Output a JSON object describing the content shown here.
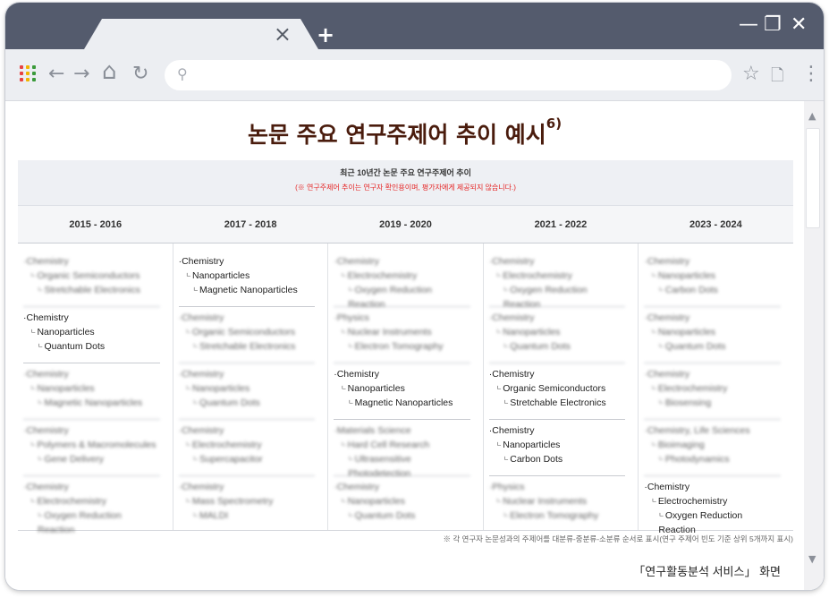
{
  "browser": {
    "tab_close": "×",
    "new_tab": "+",
    "window_controls": {
      "minimize": "—",
      "restore": "❐",
      "close": "✕"
    },
    "toolbar": {
      "back": "←",
      "forward": "→",
      "home": "⌂",
      "reload": "↻",
      "bookmark": "☆",
      "page": "🗋",
      "menu": "⋮",
      "address_value": ""
    },
    "icons": [
      "apps-icon",
      "back-icon",
      "forward-icon",
      "home-icon",
      "reload-icon",
      "search-icon",
      "star-icon",
      "page-icon",
      "menu-icon"
    ],
    "accent_color": "#545b6d"
  },
  "page": {
    "title": "논문 주요 연구주제어 추이 예시",
    "title_sup": "6)",
    "panel_title": "최근 10년간 논문 주요 연구주제어 추이",
    "panel_note": "(※ 연구주제어 추이는 연구자 확인용이며, 평가자에게 제공되지 않습니다.)",
    "years": [
      "2015 - 2016",
      "2017 - 2018",
      "2019 - 2020",
      "2021 - 2022",
      "2023 - 2024"
    ],
    "columns": [
      {
        "entries": [
          {
            "blurred": true,
            "l1": "Chemistry",
            "l2": "Organic Semiconductors",
            "l3": "Stretchable Electronics"
          },
          {
            "blurred": false,
            "l1": "Chemistry",
            "l2": "Nanoparticles",
            "l3": "Quantum Dots"
          },
          {
            "blurred": true,
            "l1": "Chemistry",
            "l2": "Nanoparticles",
            "l3": "Magnetic Nanoparticles"
          },
          {
            "blurred": true,
            "l1": "Chemistry",
            "l2": "Polymers & Macromolecules",
            "l3": "Gene Delivery"
          },
          {
            "blurred": true,
            "l1": "Chemistry",
            "l2": "Electrochemistry",
            "l3": "Oxygen Reduction Reaction"
          }
        ]
      },
      {
        "entries": [
          {
            "blurred": false,
            "l1": "Chemistry",
            "l2": "Nanoparticles",
            "l3": "Magnetic Nanoparticles"
          },
          {
            "blurred": true,
            "l1": "Chemistry",
            "l2": "Organic Semiconductors",
            "l3": "Stretchable Electronics"
          },
          {
            "blurred": true,
            "l1": "Chemistry",
            "l2": "Nanoparticles",
            "l3": "Quantum Dots"
          },
          {
            "blurred": true,
            "l1": "Chemistry",
            "l2": "Electrochemistry",
            "l3": "Supercapacitor"
          },
          {
            "blurred": true,
            "l1": "Chemistry",
            "l2": "Mass Spectrometry",
            "l3": "MALDI"
          }
        ]
      },
      {
        "entries": [
          {
            "blurred": true,
            "l1": "Chemistry",
            "l2": "Electrochemistry",
            "l3": "Oxygen Reduction Reaction"
          },
          {
            "blurred": true,
            "l1": "Physics",
            "l2": "Nuclear Instruments",
            "l3": "Electron Tomography"
          },
          {
            "blurred": false,
            "l1": "Chemistry",
            "l2": "Nanoparticles",
            "l3": "Magnetic Nanoparticles"
          },
          {
            "blurred": true,
            "l1": "Materials Science",
            "l2": "Hard Cell Research",
            "l3": "Ultrasensitive Photodetection"
          },
          {
            "blurred": true,
            "l1": "Chemistry",
            "l2": "Nanoparticles",
            "l3": "Quantum Dots"
          }
        ]
      },
      {
        "entries": [
          {
            "blurred": true,
            "l1": "Chemistry",
            "l2": "Electrochemistry",
            "l3": "Oxygen Reduction Reaction"
          },
          {
            "blurred": true,
            "l1": "Chemistry",
            "l2": "Nanoparticles",
            "l3": "Quantum Dots"
          },
          {
            "blurred": false,
            "l1": "Chemistry",
            "l2": "Organic Semiconductors",
            "l3": "Stretchable Electronics"
          },
          {
            "blurred": false,
            "l1": "Chemistry",
            "l2": "Nanoparticles",
            "l3": "Carbon Dots"
          },
          {
            "blurred": true,
            "l1": "Physics",
            "l2": "Nuclear Instruments",
            "l3": "Electron Tomography"
          }
        ]
      },
      {
        "entries": [
          {
            "blurred": true,
            "l1": "Chemistry",
            "l2": "Nanoparticles",
            "l3": "Carbon Dots"
          },
          {
            "blurred": true,
            "l1": "Chemistry",
            "l2": "Nanoparticles",
            "l3": "Quantum Dots"
          },
          {
            "blurred": true,
            "l1": "Chemistry",
            "l2": "Electrochemistry",
            "l3": "Biosensing"
          },
          {
            "blurred": true,
            "l1": "Chemistry, Life Sciences",
            "l2": "Bioimaging",
            "l3": "Photodynamics"
          },
          {
            "blurred": false,
            "l1": "Chemistry",
            "l2": "Electrochemistry",
            "l3": "Oxygen Reduction Reaction"
          }
        ]
      }
    ],
    "footnote": "※ 각 연구자 논문성과의 주제어를 대분류-중분류-소분류 순서로 표시(연구 주제어 빈도 기준 상위 5개까지 표시)",
    "caption": "「연구활동분석 서비스」 화면"
  }
}
